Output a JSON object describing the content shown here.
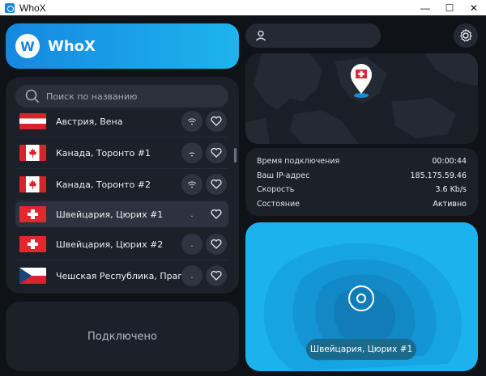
{
  "window": {
    "title": "WhoX",
    "controls": {
      "minimize": "—",
      "maximize": "☐",
      "close": "✕"
    }
  },
  "brand": {
    "logo_letter": "W",
    "name": "WhoX",
    "color": "#1488e0"
  },
  "search": {
    "placeholder": "Поиск по названию",
    "value": ""
  },
  "servers": [
    {
      "flag": "AT",
      "label": "Австрия, Вена",
      "signal": "wifi-icon",
      "favorite": false
    },
    {
      "flag": "CA",
      "label": "Канада, Торонто #1",
      "signal": "wifi-icon",
      "favorite": false
    },
    {
      "flag": "CA",
      "label": "Канада, Торонто #2",
      "signal": "wifi-icon",
      "favorite": false
    },
    {
      "flag": "CH",
      "label": "Швейцария, Цюрих #1",
      "signal": ".",
      "favorite": false,
      "selected": true
    },
    {
      "flag": "CH",
      "label": "Швейцария, Цюрих #2",
      "signal": ".",
      "favorite": false
    },
    {
      "flag": "CZ",
      "label": "Чешская Республика, Прага",
      "signal": ".",
      "favorite": false
    }
  ],
  "status": {
    "text": "Подключено"
  },
  "connection_info": [
    {
      "key": "Время подключения",
      "value": "00:00:44"
    },
    {
      "key": "Ваш IP-адрес",
      "value": "185.175.59.46"
    },
    {
      "key": "Скорость",
      "value": "3.6 Kb/s"
    },
    {
      "key": "Состояние",
      "value": "Активно"
    }
  ],
  "current_server": {
    "label": "Швейцария, Цюрих #1"
  },
  "colors": {
    "accent": "#1cb2ee",
    "panel": "#1b2029",
    "background": "#0f1318"
  }
}
